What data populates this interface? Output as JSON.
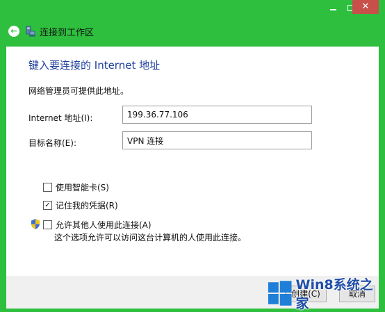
{
  "window": {
    "title": "连接到工作区",
    "controls": {
      "minimize_icon": "minimize-icon",
      "maximize_icon": "maximize-icon",
      "close_glyph": "✕"
    }
  },
  "page": {
    "heading": "键入要连接的 Internet 地址",
    "description": "网络管理员可提供此地址。"
  },
  "form": {
    "address_label": "Internet 地址(I):",
    "address_value": "199.36.77.106",
    "name_label": "目标名称(E):",
    "name_value": "VPN 连接"
  },
  "options": {
    "smart_card": {
      "label": "使用智能卡(S)",
      "checked": false
    },
    "remember": {
      "label": "记住我的凭据(R)",
      "checked": true,
      "check_glyph": "✓"
    },
    "allow_others": {
      "label": "允许其他人使用此连接(A)",
      "checked": false
    },
    "allow_note": "这个选项允许可以访问这台计算机的人使用此连接。"
  },
  "buttons": {
    "create_label": "创建(C)",
    "cancel_label": "取消"
  },
  "watermark": {
    "text": "Win8系统之家"
  },
  "colors": {
    "frame": "#2dbf3d",
    "heading": "#1e3f9e",
    "close": "#c7504b"
  }
}
